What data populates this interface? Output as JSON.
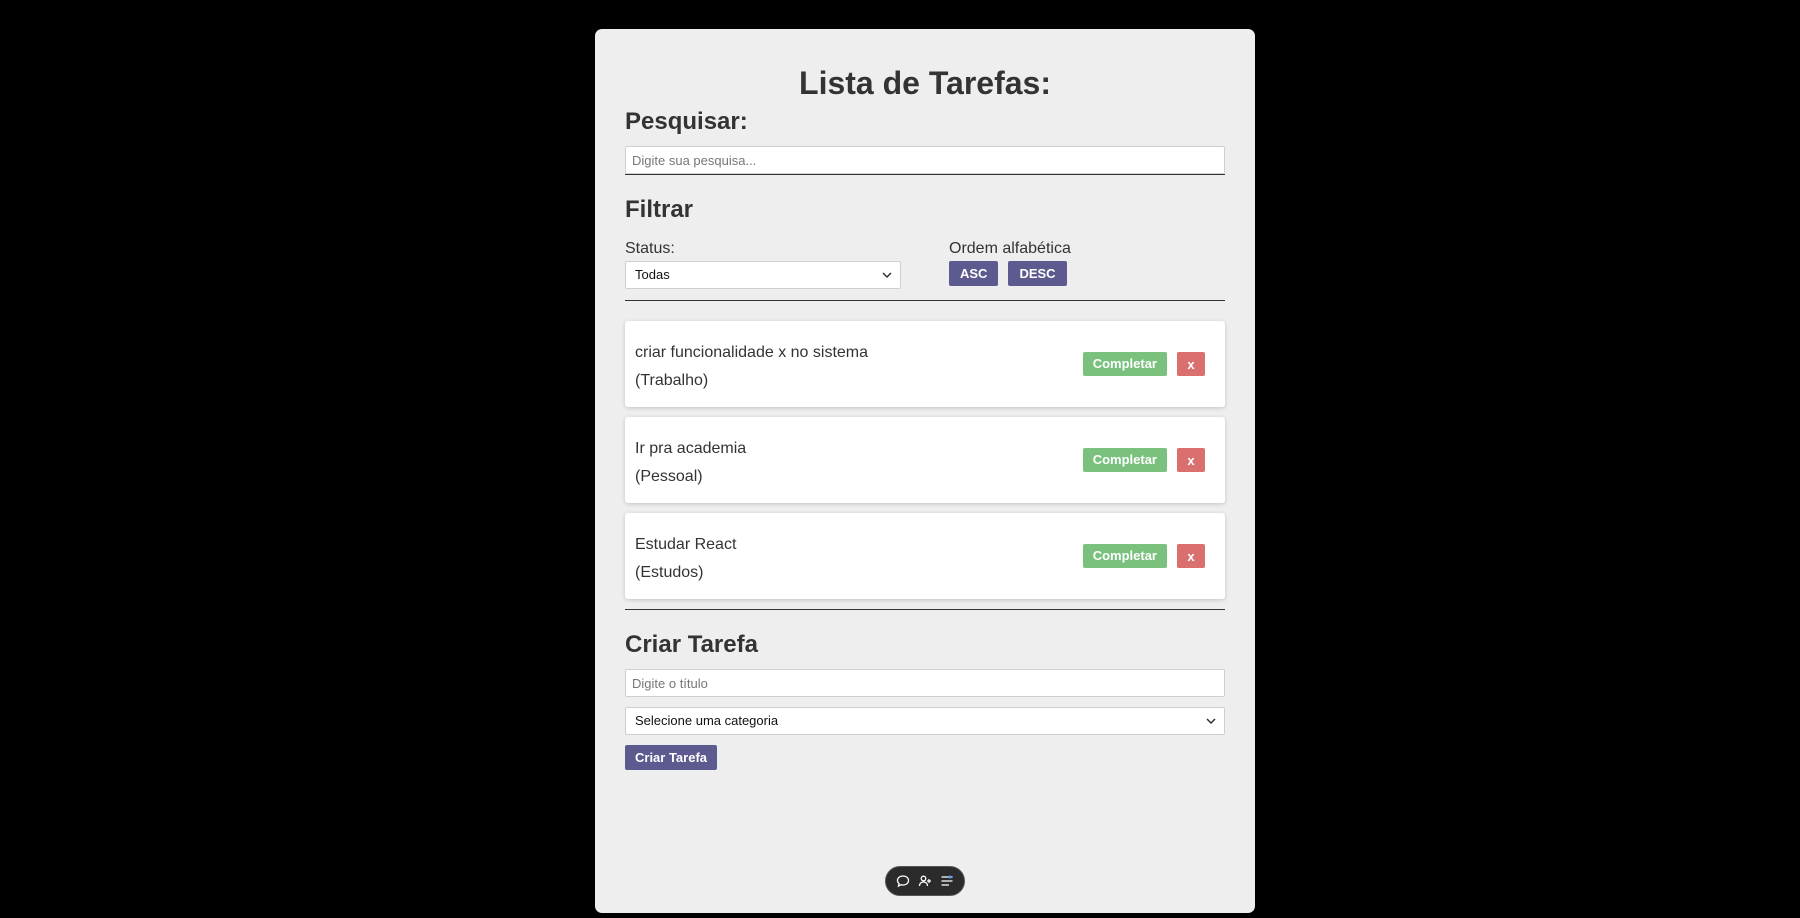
{
  "page": {
    "title": "Lista de Tarefas:"
  },
  "search": {
    "title": "Pesquisar:",
    "placeholder": "Digite sua pesquisa...",
    "value": ""
  },
  "filter": {
    "title": "Filtrar",
    "status_label": "Status:",
    "status_selected": "Todas",
    "order_label": "Ordem alfabética",
    "asc_label": "ASC",
    "desc_label": "DESC"
  },
  "todos": [
    {
      "text": "criar funcionalidade x no sistema",
      "category": "(Trabalho)",
      "complete_label": "Completar",
      "delete_label": "x"
    },
    {
      "text": "Ir pra academia",
      "category": "(Pessoal)",
      "complete_label": "Completar",
      "delete_label": "x"
    },
    {
      "text": "Estudar React",
      "category": "(Estudos)",
      "complete_label": "Completar",
      "delete_label": "x"
    }
  ],
  "create": {
    "title": "Criar Tarefa",
    "title_placeholder": "Digite o título",
    "category_selected": "Selecione uma categoria",
    "submit_label": "Criar Tarefa"
  },
  "floating_toolbar": {
    "icons": [
      "chat-bubble-icon",
      "add-person-icon",
      "filter-settings-icon"
    ]
  },
  "colors": {
    "background": "#000000",
    "panel": "#eeeeee",
    "primary_button": "#5c5a8f",
    "complete_button": "#7ac17e",
    "delete_button": "#d9706f"
  }
}
